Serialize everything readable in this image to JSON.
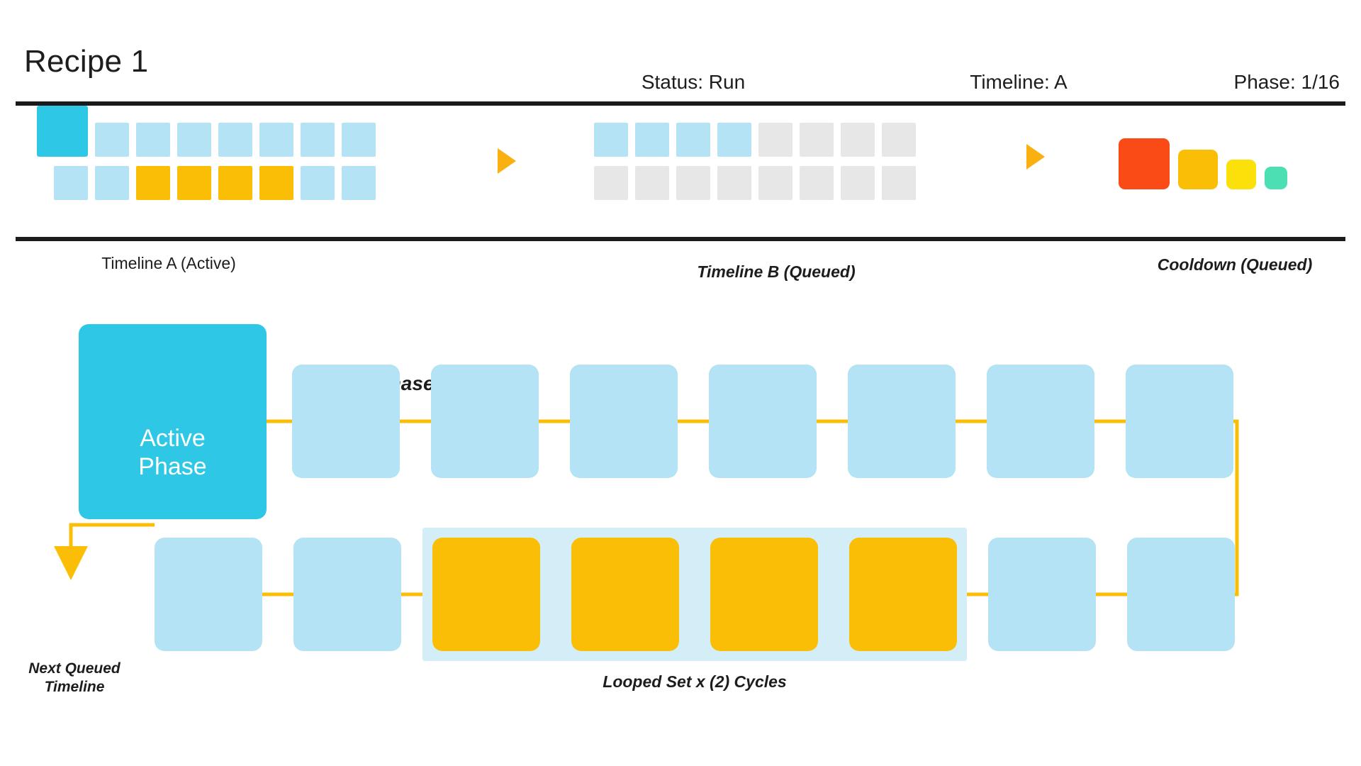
{
  "header": {
    "title": "Recipe 1",
    "status_label": "Status: Run",
    "timeline_label": "Timeline: A",
    "phase_label": "Phase: 1/16"
  },
  "colors": {
    "active_cyan": "#2ec8e6",
    "queued_blue": "#b3e3f4",
    "loop_orange": "#fbbe07",
    "idle_gray": "#e7e7e8",
    "connector": "#fbbe07",
    "arrow": "#fbb011",
    "band_fill": "#d4eef8",
    "rule": "#1a1a1a",
    "cooldown_red": "#fa4b16",
    "cooldown_orange": "#fbbe07",
    "cooldown_yellow": "#fbe00a",
    "cooldown_green": "#4ddfb4"
  },
  "strip": {
    "timeline_a": {
      "caption": "Timeline A (Active)",
      "caption_italic": false,
      "rows": [
        [
          "active",
          "queued",
          "queued",
          "queued",
          "queued",
          "queued",
          "queued",
          "queued"
        ],
        [
          "queued",
          "queued",
          "loop",
          "loop",
          "loop",
          "loop",
          "queued",
          "queued"
        ]
      ]
    },
    "arrow_a_to_b": "play-arrow",
    "timeline_b": {
      "caption": "Timeline B (Queued)",
      "caption_italic": true,
      "rows": [
        [
          "queued",
          "queued",
          "queued",
          "queued",
          "idle",
          "idle",
          "idle",
          "idle"
        ],
        [
          "idle",
          "idle",
          "idle",
          "idle",
          "idle",
          "idle",
          "idle",
          "idle"
        ]
      ]
    },
    "arrow_b_to_cooldown": "play-arrow",
    "cooldown": {
      "caption": "Cooldown (Queued)",
      "caption_italic": true,
      "blocks": [
        {
          "color_key": "cooldown_red",
          "size": 72
        },
        {
          "color_key": "cooldown_orange",
          "size": 56
        },
        {
          "color_key": "cooldown_yellow",
          "size": 42
        },
        {
          "color_key": "cooldown_green",
          "size": 32
        }
      ]
    }
  },
  "phase_grid": {
    "active_phase_text_line1": "Active",
    "active_phase_text_line2": "Phase",
    "queued_label": "Queued Phases > >",
    "loop_label": "Looped Set x (2) Cycles",
    "next_queued_label_line1": "Next Queued",
    "next_queued_label_line2": "Timeline",
    "row1": [
      {
        "kind": "active"
      },
      {
        "kind": "queued"
      },
      {
        "kind": "queued"
      },
      {
        "kind": "queued"
      },
      {
        "kind": "queued"
      },
      {
        "kind": "queued"
      },
      {
        "kind": "queued"
      },
      {
        "kind": "queued"
      }
    ],
    "row2": [
      {
        "kind": "queued"
      },
      {
        "kind": "queued"
      },
      {
        "kind": "loop"
      },
      {
        "kind": "loop"
      },
      {
        "kind": "loop"
      },
      {
        "kind": "loop"
      },
      {
        "kind": "queued"
      },
      {
        "kind": "queued"
      }
    ]
  }
}
